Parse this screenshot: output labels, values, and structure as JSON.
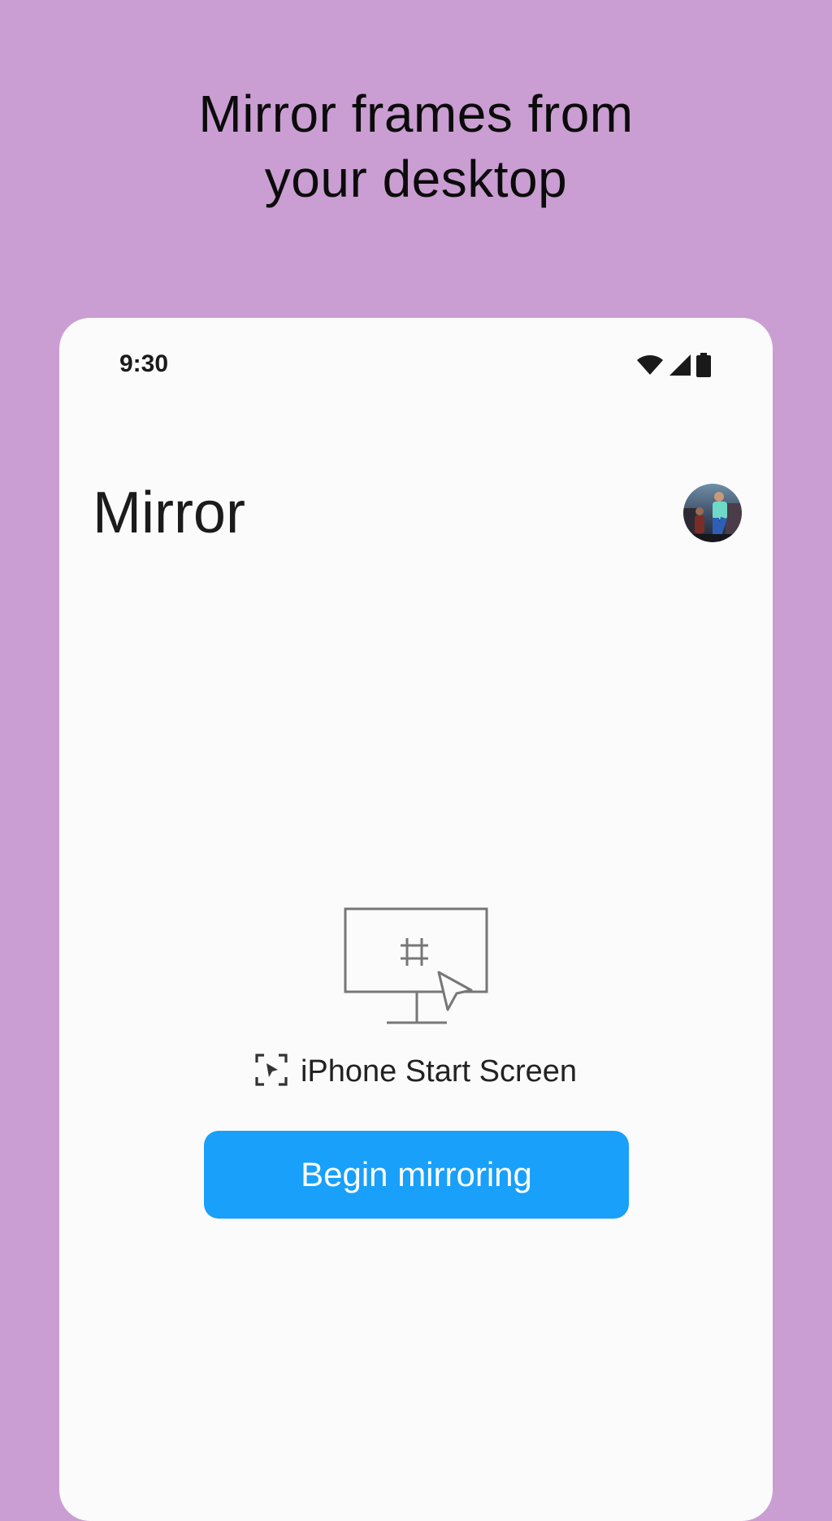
{
  "headline": {
    "line1": "Mirror frames from",
    "line2": "your desktop"
  },
  "status_bar": {
    "time": "9:30",
    "icons": [
      "wifi-icon",
      "cellular-signal-icon",
      "battery-icon"
    ]
  },
  "app_bar": {
    "title": "Mirror",
    "avatar_icon": "user-avatar"
  },
  "main": {
    "illustration_icon": "monitor-frame-cursor-illustration",
    "source_icon": "screen-capture-icon",
    "source_label": "iPhone Start Screen",
    "begin_button_label": "Begin mirroring"
  },
  "colors": {
    "background": "#CA9ED2",
    "card": "#FBFBFB",
    "accent": "#18A0FB"
  }
}
